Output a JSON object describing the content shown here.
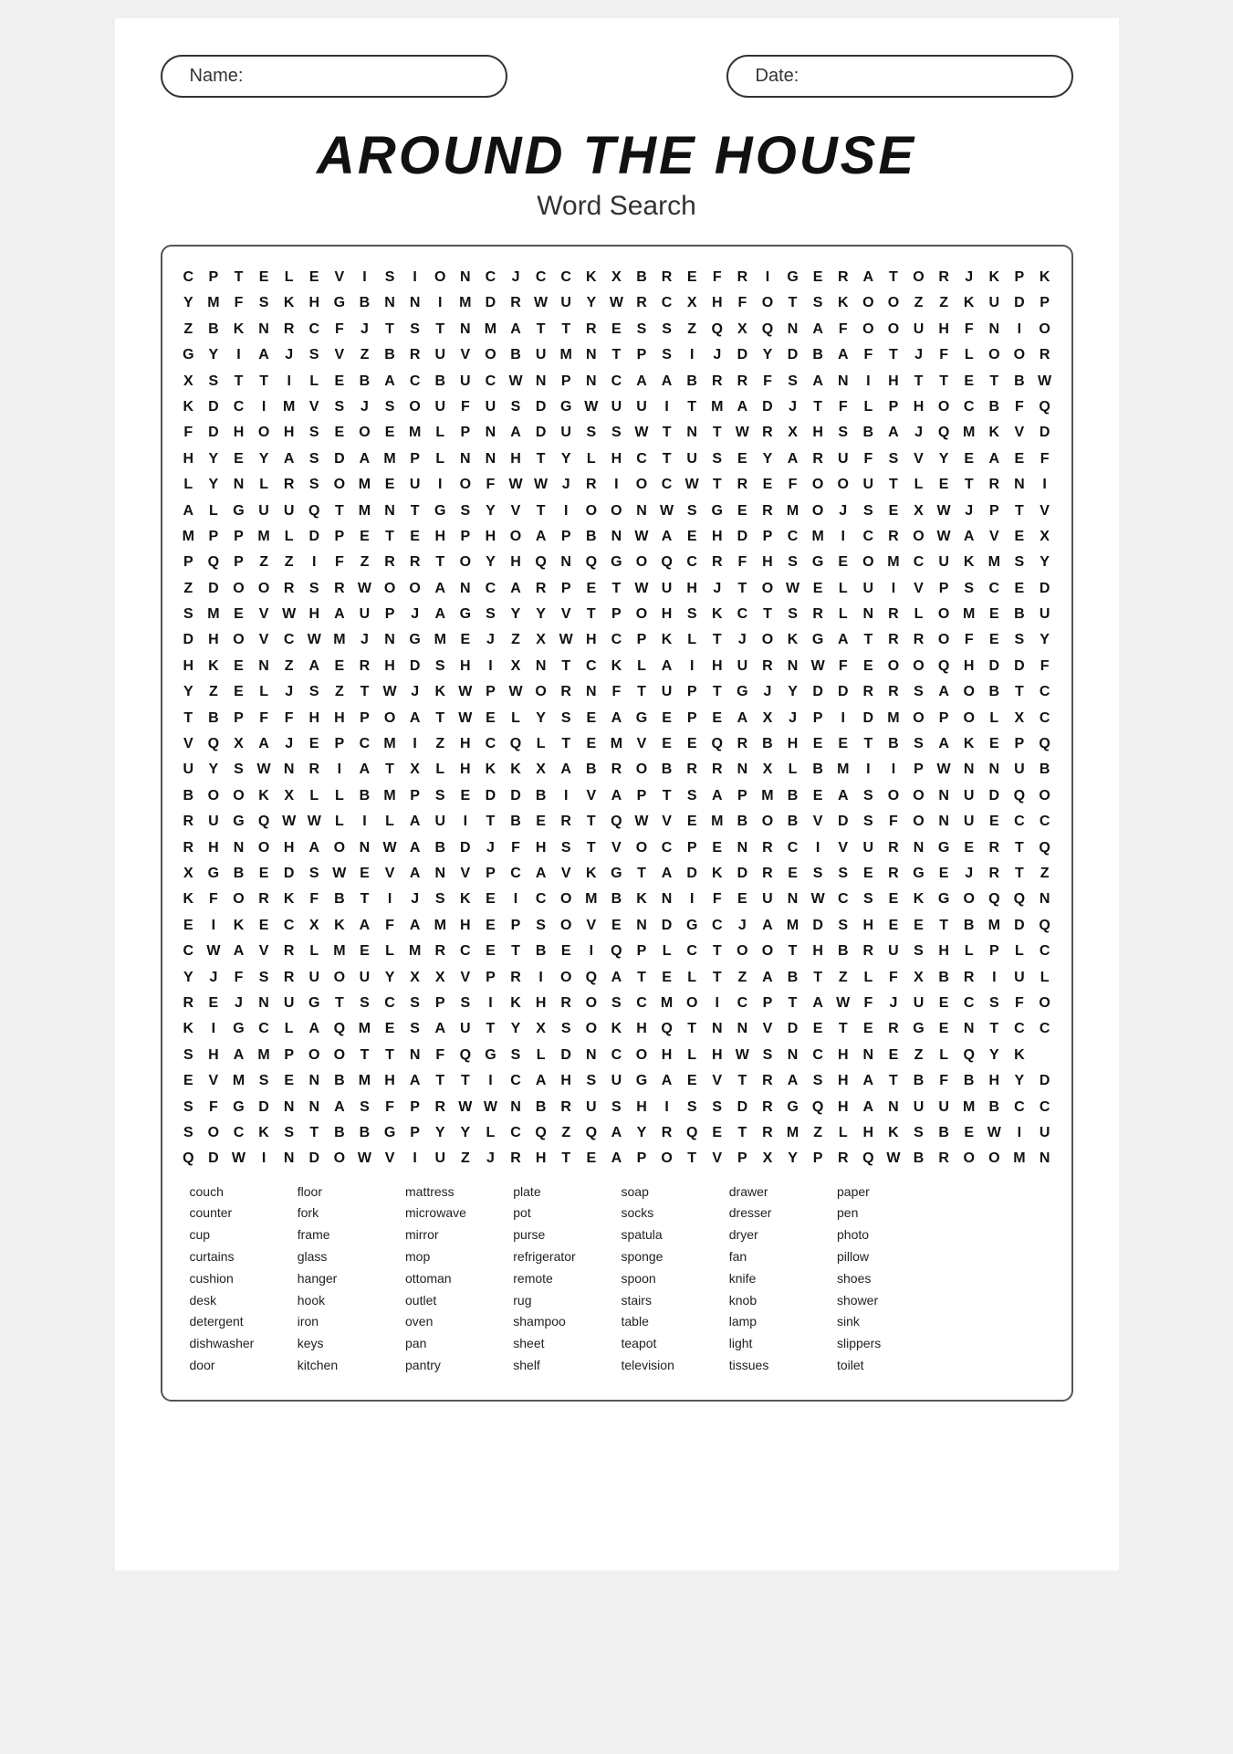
{
  "header": {
    "name_label": "Name:",
    "date_label": "Date:"
  },
  "title": {
    "main": "Around The House",
    "subtitle": "Word Search"
  },
  "grid": {
    "rows": [
      "C P T E L E V I S I O N C J C C K X B R E F R I G E R A T O R J K P K",
      "Y M F S K H G B N N I M D R W U Y W R C X H F O T S K O O Z Z K U D P",
      "Z B K N R C F J T S T N M A T T R E S S Z Q X Q N A F O O U H F N I O",
      "G Y I A J S V Z B R U V O B U M N T P S I J D Y D B A F T J F L O O R",
      "X S T T I L E B A C B U C W N P N C A A B R R F S A N I H T T E T B W",
      "K D C I M V S J S O U F U S D G W U U I T M A D J T F L P H O C B F Q",
      "F D H O H S E O E M L P N A D U S S W T N T W R X H S B A J Q M K V D",
      "H Y E Y A S D A M P L N N H T Y L H C T U S E Y A R U F S V Y E A E F",
      "L Y N L R S O M E U I O F W W J R I O C W T R E F O O U T L E T R N I",
      "A L G U U Q T M N T G S Y V T I O O N W S G E R M O J S E X W J P T V",
      "M P P M L D P E T E H P H O A P B N W A E H D P C M I C R O W A V E X",
      "P Q P Z Z I F Z R R T O Y H Q N Q G O Q C R F H S G E O M C U K M S Y",
      "Z D O O R S R W O O A N C A R P E T W U H J T O W E L U I V P S C E D",
      "S M E V W H A U P J A G S Y Y V T P O H S K C T S R L N R L O M E B U",
      "D H O V C W M J N G M E J Z X W H C P K L T J O K G A T R R O F E S Y",
      "H K E N Z A E R H D S H I X N T C K L A I H U R N W F E O O Q H D D F",
      "Y Z E L J S Z T W J K W P W O R N F T U P T G J Y D D R R S A O B T C",
      "T B P F F H H P O A T W E L Y S E A G E P E A X J P I D M O P O L X C",
      "V Q X A J E P C M I Z H C Q L T E M V E E Q R B H E E T B S A K E P Q",
      "U Y S W N R I A T X L H K K X A B R O B R R N X L B M I I P W N N U B",
      "B O O K X L L B M P S E D D B I V A P T S A P M B E A S O O N U D Q O",
      "R U G Q W W L I L A U I T B E R T Q W V E M B O B V D S F O N U E C C",
      "R H N O H A O N W A B D J F H S T V O C P E N R C I V U R N G E R T Q",
      "X G B E D S W E V A N V P C A V K G T A D K D R E S S E R G E J R T Z",
      "K F O R K F B T I J S K E I C O M B K N I F E U N W C S E K G O Q Q N",
      "E I K E C X K A F A M H E P S O V E N D G C J A M D S H E E T B M D Q",
      "C W A V R L M E L M R C E T B E I Q P L C T O O T H B R U S H L P L C",
      "Y J F S R U O U Y X X V P R I O Q A T E L T Z A B T Z L F X B R I U L",
      "R E J N U G T S C S P S I K H R O S C M O I C P T A W F J U E C S F O",
      "K I G C L A Q M E S A U T Y X S O K H Q T N N V D E T E R G E N T C C",
      "S H A M P O O T T N F Q G S L D N C O H L H W S N C H N E Z L Q Y K",
      "E V M S E N B M H A T T I C A H S U G A E V T R A S H A T B F B H Y D",
      "S F G D N N A S F P R W W N B R U S H I S S D R G Q H A N U U M B C C",
      "S O C K S T B B G P Y Y L C Q Z Q A Y R Q E T R M Z L H K S B E W I U",
      "Q D W I N D O W V I U Z J R H T E A P O T V P X Y P R Q W B R O O M N"
    ]
  },
  "words": {
    "columns": [
      [
        "couch",
        "counter",
        "cup",
        "curtains",
        "cushion",
        "desk",
        "detergent",
        "dishwasher",
        "door"
      ],
      [
        "floor",
        "fork",
        "frame",
        "glass",
        "hanger",
        "hook",
        "iron",
        "keys",
        "kitchen"
      ],
      [
        "mattress",
        "microwave",
        "mirror",
        "mop",
        "ottoman",
        "outlet",
        "oven",
        "pan",
        "pantry"
      ],
      [
        "plate",
        "pot",
        "purse",
        "refrigerator",
        "remote",
        "rug",
        "shampoo",
        "sheet",
        "shelf"
      ],
      [
        "soap",
        "socks",
        "spatula",
        "sponge",
        "spoon",
        "stairs",
        "table",
        "teapot",
        "television"
      ],
      [
        "drawer",
        "dresser",
        "dryer",
        "fan",
        "knife",
        "knob",
        "lamp",
        "light",
        "tissues"
      ],
      [
        "paper",
        "pen",
        "photo",
        "pillow",
        "shoes",
        "shower",
        "sink",
        "slippers",
        "toilet"
      ]
    ]
  }
}
